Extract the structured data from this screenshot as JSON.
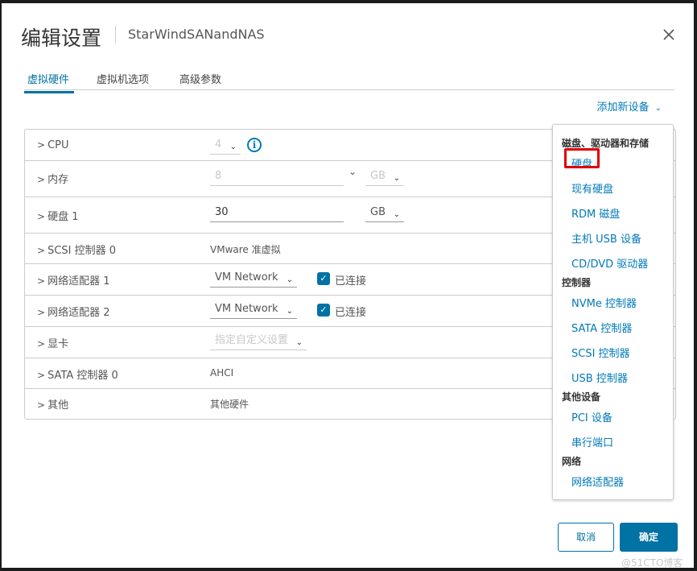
{
  "dialog": {
    "title": "编辑设置",
    "subtitle": "StarWindSANandNAS",
    "close_icon": "close-icon"
  },
  "tabs": [
    {
      "label": "虚拟硬件",
      "active": true
    },
    {
      "label": "虚拟机选项",
      "active": false
    },
    {
      "label": "高级参数",
      "active": false
    }
  ],
  "add_device": {
    "label": "添加新设备",
    "chevron": "⌄"
  },
  "hardware": {
    "cpu": {
      "label": "CPU",
      "value": "4"
    },
    "memory": {
      "label": "内存",
      "value": "8",
      "unit": "GB"
    },
    "disk1": {
      "label": "硬盘 1",
      "value": "30",
      "unit": "GB"
    },
    "scsi0": {
      "label": "SCSI 控制器 0",
      "value": "VMware 准虚拟"
    },
    "nic1": {
      "label": "网络适配器 1",
      "network": "VM Network",
      "connected_label": "已连接",
      "connected": true
    },
    "nic2": {
      "label": "网络适配器 2",
      "network": "VM Network",
      "connected_label": "已连接",
      "connected": true
    },
    "video": {
      "label": "显卡",
      "value": "指定自定义设置"
    },
    "sata0": {
      "label": "SATA 控制器 0",
      "value": "AHCI"
    },
    "other": {
      "label": "其他",
      "value": "其他硬件"
    }
  },
  "menu": {
    "groups": [
      {
        "header": "磁盘、驱动器和存储",
        "items": [
          "硬盘",
          "现有硬盘",
          "RDM 磁盘",
          "主机 USB 设备",
          "CD/DVD 驱动器"
        ]
      },
      {
        "header": "控制器",
        "items": [
          "NVMe 控制器",
          "SATA 控制器",
          "SCSI 控制器",
          "USB 控制器"
        ]
      },
      {
        "header": "其他设备",
        "items": [
          "PCI 设备",
          "串行端口"
        ]
      },
      {
        "header": "网络",
        "items": [
          "网络适配器"
        ]
      }
    ],
    "highlighted_item": "硬盘"
  },
  "footer": {
    "cancel_label": "取消",
    "ok_label": "确定"
  },
  "watermark": "@51CTO博客"
}
